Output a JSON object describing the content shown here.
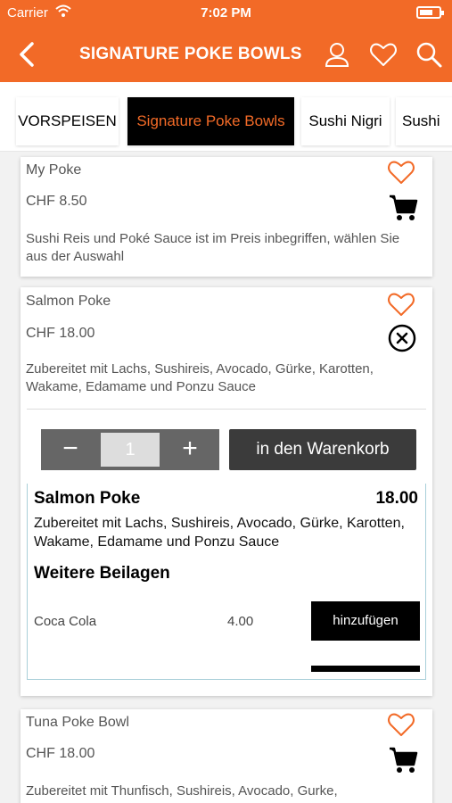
{
  "status_bar": {
    "carrier": "Carrier",
    "time": "7:02 PM"
  },
  "nav": {
    "title": "SIGNATURE POKE BOWLS",
    "icons": [
      "back-chevron-icon",
      "user-icon",
      "heart-icon",
      "search-icon"
    ]
  },
  "tabs": [
    {
      "label": "VORSPEISEN",
      "active": false
    },
    {
      "label": "Signature Poke Bowls",
      "active": true
    },
    {
      "label": "Sushi Nigri",
      "active": false
    },
    {
      "label": "Sushi",
      "active": false
    }
  ],
  "items": [
    {
      "name": "My Poke",
      "price": "CHF 8.50",
      "description": "Sushi Reis und Poké Sauce ist im Preis inbegriffen, wählen Sie aus der Auswahl"
    },
    {
      "name": "Salmon Poke",
      "price": "CHF 18.00",
      "description": "Zubereitet mit Lachs, Sushireis, Avocado, Gürke, Karotten, Wakame, Edamame und Ponzu Sauce",
      "expanded": {
        "quantity": "1",
        "minus": "−",
        "plus": "+",
        "add_to_cart": "in den Warenkorb",
        "detail_name": "Salmon Poke",
        "detail_price": "18.00",
        "detail_description": "Zubereitet mit Lachs, Sushireis, Avocado, Gürke, Karotten, Wakame, Edamame und Ponzu Sauce",
        "section_title": "Weitere Beilagen",
        "sides": [
          {
            "name": "Coca Cola",
            "price": "4.00",
            "button": "hinzufügen"
          }
        ]
      }
    },
    {
      "name": "Tuna Poke Bowl",
      "price": "CHF 18.00",
      "description": "Zubereitet mit Thunfisch, Sushireis, Avocado, Gurke,"
    }
  ],
  "colors": {
    "brand": "#f26a27",
    "active_tab_bg": "#000000",
    "button_dark": "#3b3b3b"
  }
}
